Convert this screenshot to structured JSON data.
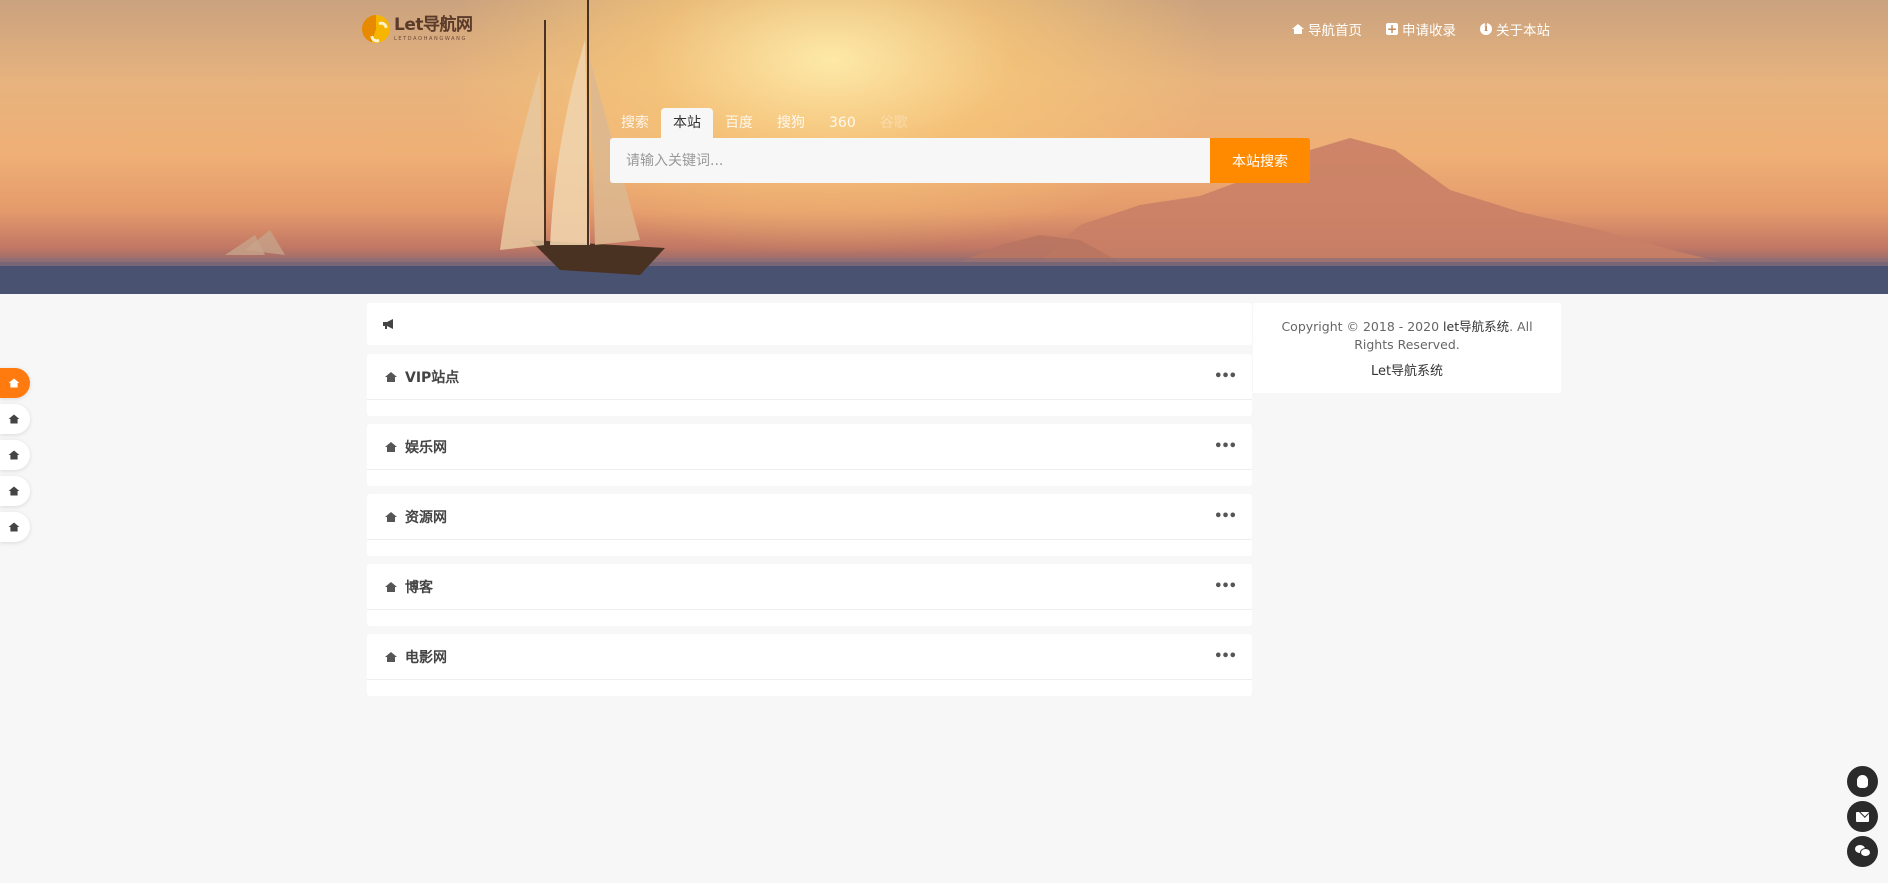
{
  "logo": {
    "title": "Let导航网",
    "subtitle": "LETDAOHANGWANG"
  },
  "topnav": [
    {
      "label": "导航首页",
      "icon": "home-icon"
    },
    {
      "label": "申请收录",
      "icon": "plus-square-icon"
    },
    {
      "label": "关于本站",
      "icon": "info-circle-icon"
    }
  ],
  "search": {
    "tabs": [
      "搜索",
      "本站",
      "百度",
      "搜狗",
      "360",
      "谷歌"
    ],
    "active_tab": "本站",
    "placeholder": "请输入关键词...",
    "button_label": "本站搜索"
  },
  "notice": {
    "icon": "bullhorn-icon",
    "text": ""
  },
  "categories": [
    {
      "title": "VIP站点",
      "icon": "home-icon"
    },
    {
      "title": "娱乐网",
      "icon": "home-icon"
    },
    {
      "title": "资源网",
      "icon": "home-icon"
    },
    {
      "title": "博客",
      "icon": "home-icon"
    },
    {
      "title": "电影网",
      "icon": "home-icon"
    }
  ],
  "more_label": "•••",
  "sidebar": {
    "copyright_prefix": "Copyright © 2018 - 2020 ",
    "copyright_site": "let导航系统",
    "copyright_suffix": ". All Rights Reserved.",
    "footer_brand": "Let导航系统"
  },
  "colors": {
    "accent": "#ff8a00",
    "float_active": "#ff7b0f",
    "float_dark": "#2b2b2b"
  },
  "float_nav_icons": [
    "home-icon",
    "home-icon",
    "home-icon",
    "home-icon",
    "home-icon"
  ],
  "float_right": [
    "qq-icon",
    "mail-icon",
    "wechat-icon"
  ]
}
